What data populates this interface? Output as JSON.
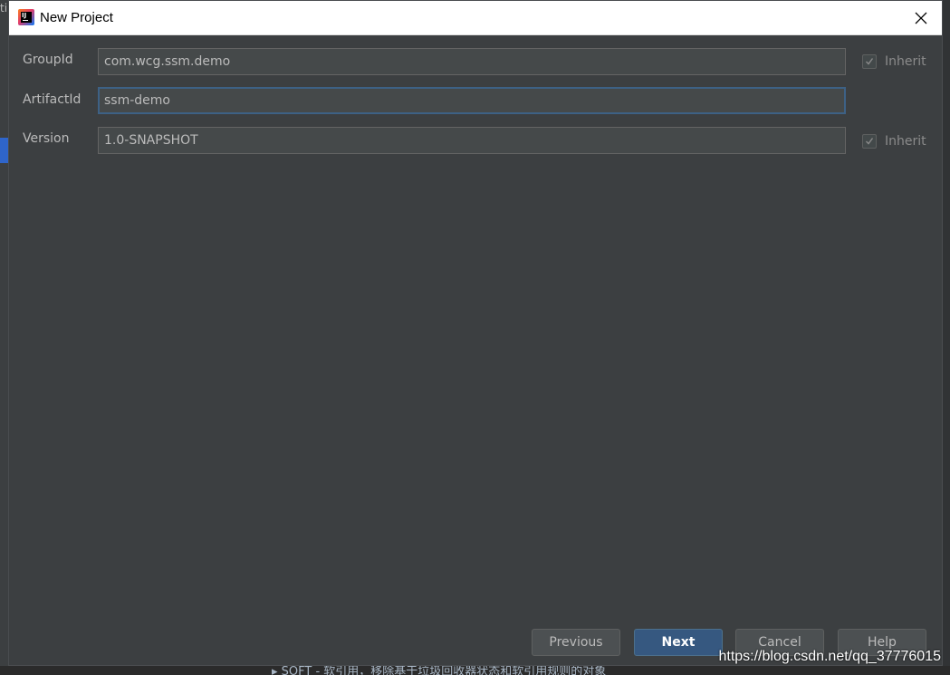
{
  "window": {
    "title": "New Project"
  },
  "background": {
    "left_text": "ti",
    "bottom_text": "▸ SOFT  - 软引用，移除基于垃圾回收器状态和软引用规则的对象"
  },
  "form": {
    "group_id": {
      "label": "GroupId",
      "value": "com.wcg.ssm.demo",
      "inherit_label": "Inherit",
      "inherit_checked": true
    },
    "artifact_id": {
      "label": "ArtifactId",
      "value": "ssm-demo"
    },
    "version": {
      "label": "Version",
      "value": "1.0-SNAPSHOT",
      "inherit_label": "Inherit",
      "inherit_checked": true
    }
  },
  "buttons": {
    "previous": "Previous",
    "next": "Next",
    "cancel": "Cancel",
    "help": "Help"
  },
  "watermark": "https://blog.csdn.net/qq_37776015",
  "colors": {
    "dialog_bg": "#3c3f41",
    "input_bg": "#45494a",
    "accent": "#365880",
    "focus_border": "#3d6185"
  }
}
